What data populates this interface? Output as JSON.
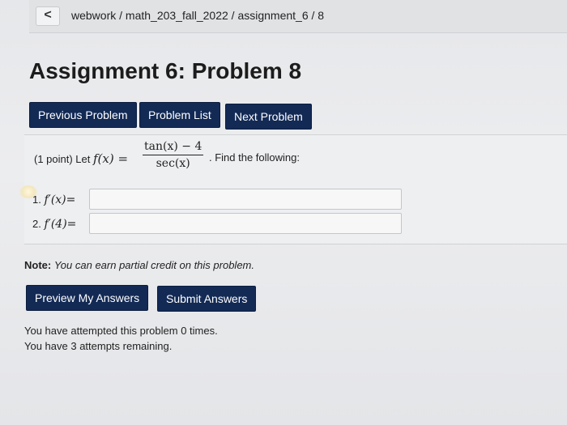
{
  "nav": {
    "back_glyph": "<",
    "breadcrumb": "webwork / math_203_fall_2022 / assignment_6 / 8"
  },
  "page_title": "Assignment 6: Problem 8",
  "problem_nav": {
    "previous": "Previous Problem",
    "list": "Problem List",
    "next": "Next Problem"
  },
  "problem": {
    "points": "(1 point) Let",
    "function": "f(x) =",
    "numerator": "tan(x) − 4",
    "denominator": "sec(x)",
    "find": ". Find the following:",
    "answers": [
      {
        "number": "1.",
        "label": "f′(x)=",
        "value": ""
      },
      {
        "number": "2.",
        "label": "f′(4)=",
        "value": ""
      }
    ]
  },
  "note": {
    "label": "Note:",
    "text": "You can earn partial credit on this problem."
  },
  "actions": {
    "preview": "Preview My Answers",
    "submit": "Submit Answers"
  },
  "status": {
    "attempted": "You have attempted this problem 0 times.",
    "remaining": "You have 3 attempts remaining."
  },
  "colors": {
    "button_bg": "#132a55",
    "button_text": "#ffffff"
  }
}
